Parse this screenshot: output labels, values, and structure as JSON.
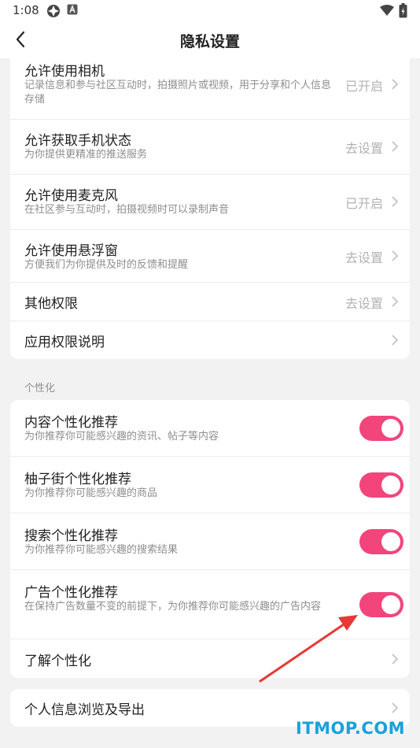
{
  "status_bar": {
    "time": "1:08"
  },
  "header": {
    "title": "隐私设置",
    "back_icon": "chevron-left-icon"
  },
  "permissions": [
    {
      "title": "允许使用相机",
      "desc": "记录信息和参与社区互动时，拍摄照片或视频，用于分享和个人信息存储",
      "status": "已开启"
    },
    {
      "title": "允许获取手机状态",
      "desc": "为你提供更精准的推送服务",
      "status": "去设置"
    },
    {
      "title": "允许使用麦克风",
      "desc": "在社区参与互动时，拍摄视频时可以录制声音",
      "status": "已开启"
    },
    {
      "title": "允许使用悬浮窗",
      "desc": "方便我们为你提供及时的反馈和提醒",
      "status": "去设置"
    },
    {
      "title": "其他权限",
      "desc": "",
      "status": "去设置"
    },
    {
      "title": "应用权限说明",
      "desc": "",
      "status": ""
    }
  ],
  "personalization": {
    "section_label": "个性化",
    "items": [
      {
        "title": "内容个性化推荐",
        "desc": "为你推荐你可能感兴趣的资讯、帖子等内容",
        "enabled": true
      },
      {
        "title": "柚子街个性化推荐",
        "desc": "为你推荐你可能感兴趣的商品",
        "enabled": true
      },
      {
        "title": "搜索个性化推荐",
        "desc": "为你推荐你可能感兴趣的搜索结果",
        "enabled": true
      },
      {
        "title": "广告个性化推荐",
        "desc": "在保持广告数量不变的前提下，为你推荐你可能感兴趣的广告内容",
        "enabled": true
      }
    ],
    "learn_more": "了解个性化"
  },
  "export": {
    "title": "个人信息浏览及导出"
  },
  "watermark": "ITMOP.COM",
  "colors": {
    "accent": "#f2457c",
    "annotation_arrow": "#e53935",
    "watermark": "#1aa0dd"
  }
}
